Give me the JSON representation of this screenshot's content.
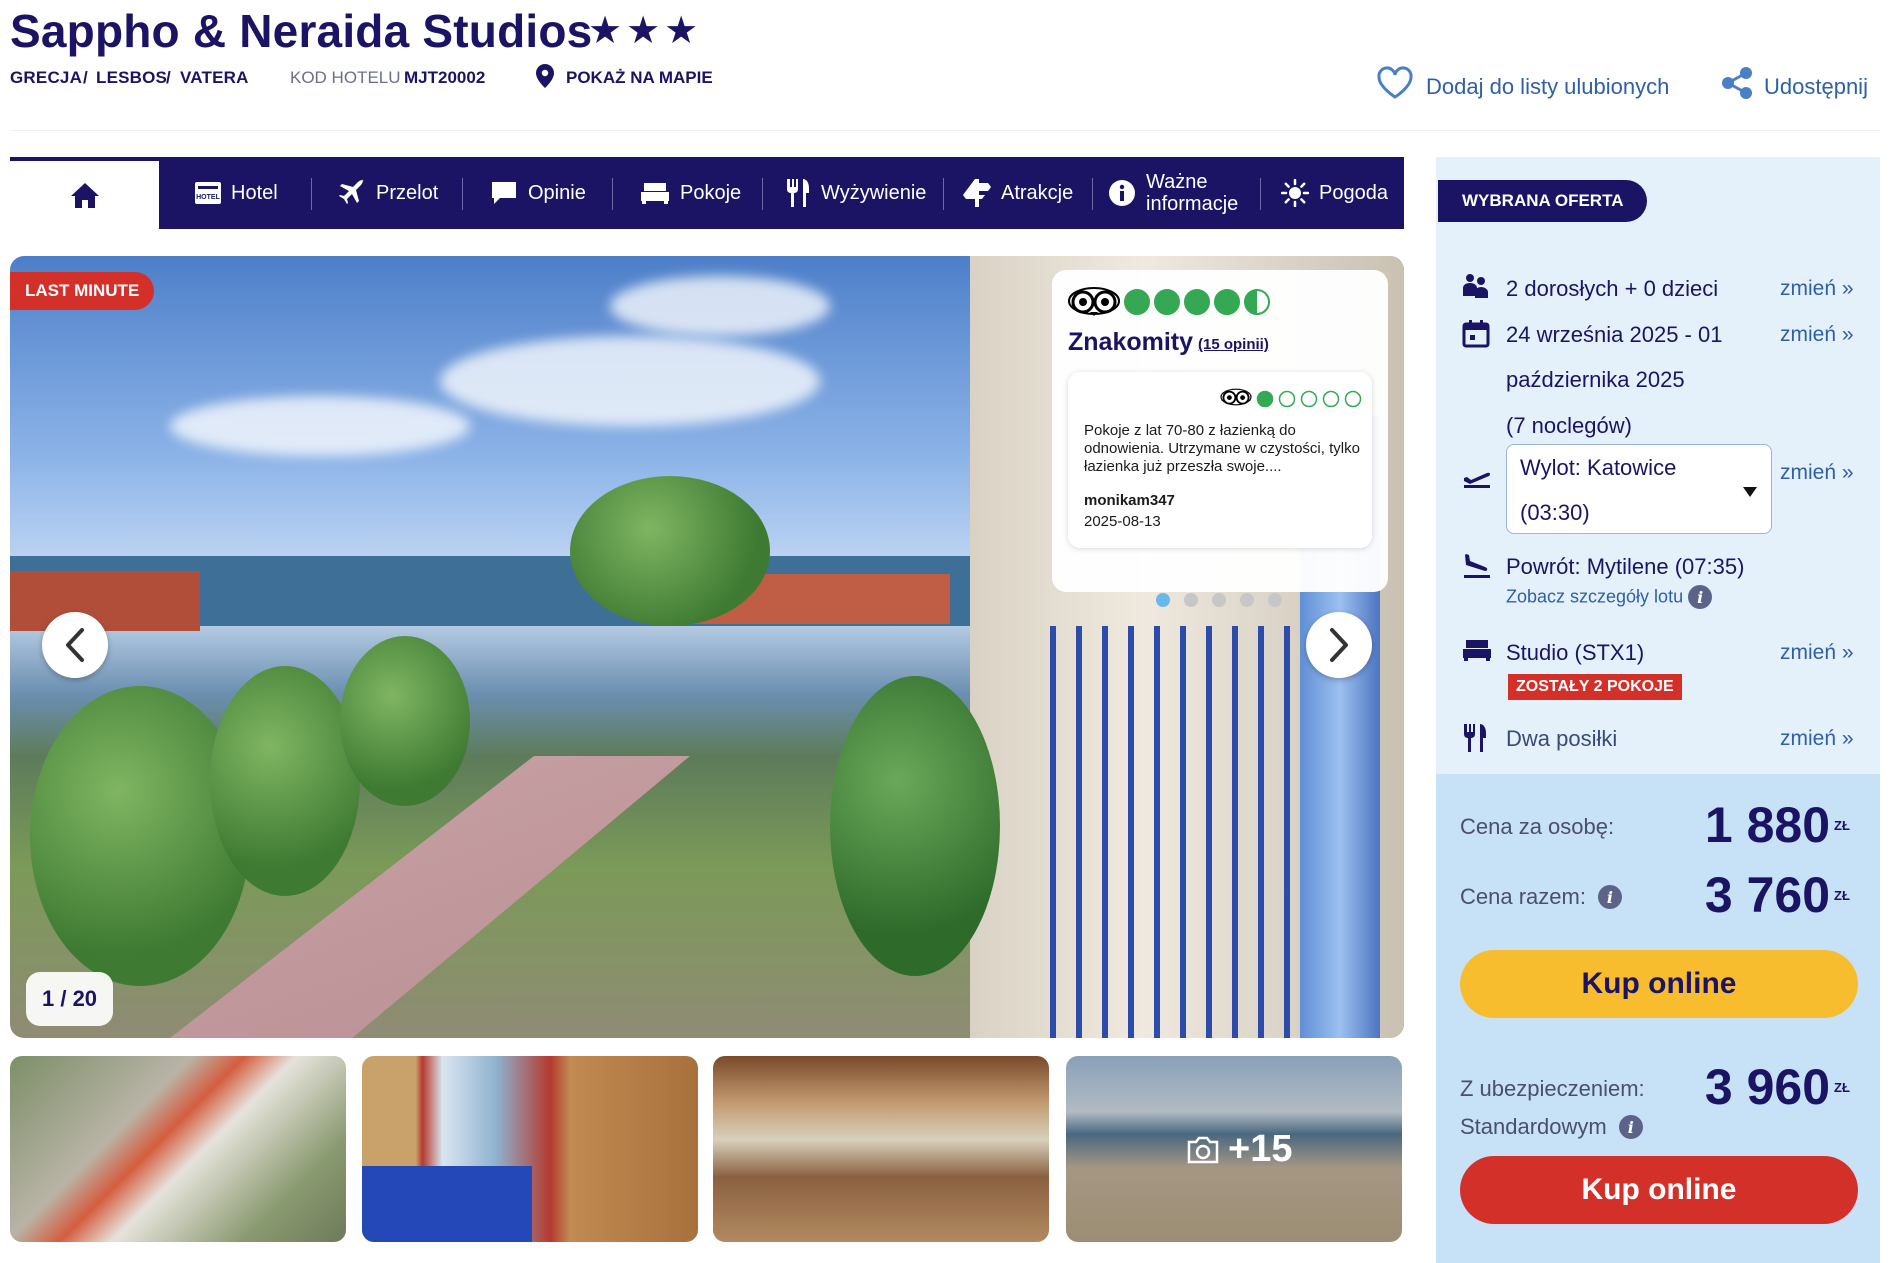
{
  "header": {
    "title": "Sappho & Neraida Studios",
    "stars": "★★★",
    "breadcrumb": [
      "GRECJA",
      "/",
      "LESBOS",
      "/",
      "VATERA"
    ],
    "hotel_code_label": "KOD HOTELU",
    "hotel_code": "MJT20002",
    "map_link": "POKAŻ NA MAPIE",
    "favorite_label": "Dodaj do listy ulubionych",
    "share_label": "Udostępnij"
  },
  "nav": {
    "items": [
      {
        "label": "Hotel"
      },
      {
        "label": "Przelot"
      },
      {
        "label": "Opinie"
      },
      {
        "label": "Pokoje"
      },
      {
        "label": "Wyżywienie"
      },
      {
        "label": "Atrakcje"
      },
      {
        "label": "Ważne informacje"
      },
      {
        "label": "Pogoda"
      }
    ]
  },
  "gallery": {
    "badge": "LAST MINUTE",
    "counter": "1 / 20",
    "more_photos": "+15",
    "dots_active": 0
  },
  "review": {
    "bubbles": 4.5,
    "label": "Znakomity",
    "count_text": "(15 opinii)",
    "item": {
      "bubbles": 1,
      "text": "Pokoje z lat 70-80 z łazienką do odnowienia. Utrzymane w czystości, tylko łazienka już przeszła swoje....",
      "user": "monikam347",
      "date": "2025-08-13"
    }
  },
  "offer": {
    "tag": "WYBRANA OFERTA",
    "change": "zmień",
    "guests": "2 dorosłych + 0 dzieci",
    "dates_line1": "24 września 2025 - 01",
    "dates_line2": "października 2025",
    "nights": "(7 noclegów)",
    "departure_line1": "Wylot: Katowice",
    "departure_line2": "(03:30)",
    "return": "Powrót: Mytilene (07:35)",
    "flight_details": "Zobacz szczegóły lotu",
    "room": "Studio (STX1)",
    "rooms_left": "ZOSTAŁY 2 POKOJE",
    "board": "Dwa posiłki",
    "price_per_person_label": "Cena za osobę:",
    "price_per_person": "1 880",
    "price_total_label": "Cena razem:",
    "price_total": "3 760",
    "currency": "ZŁ",
    "buy_label": "Kup online",
    "insurance_label_1": "Z ubezpieczeniem:",
    "insurance_label_2": "Standardowym",
    "price_insured": "3 960",
    "buy_insured_label": "Kup online",
    "colors": {
      "buy": "#f7bd2f",
      "buy_insured": "#d4302a",
      "navy": "#1b1464"
    }
  }
}
